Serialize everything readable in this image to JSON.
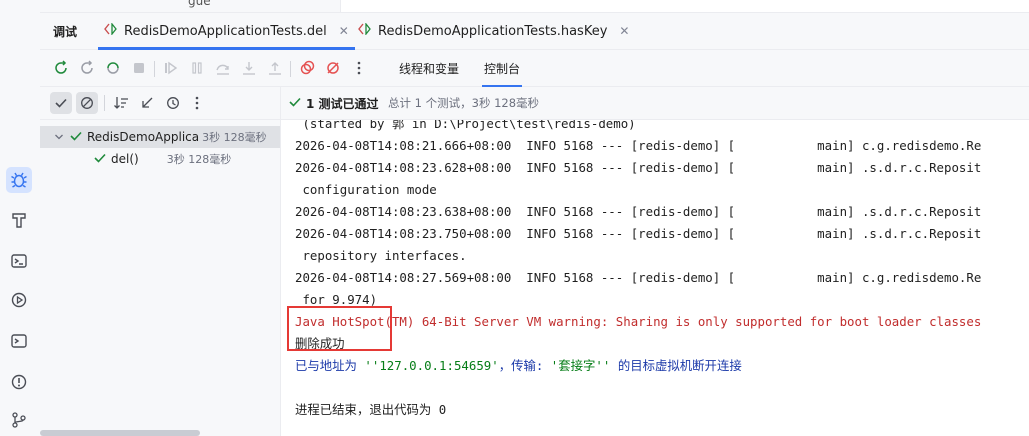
{
  "top_sliver": {
    "text": "gue"
  },
  "debug_panel": {
    "title": "调试",
    "tabs": [
      {
        "label": "RedisDemoApplicationTests.del",
        "active": true
      },
      {
        "label": "RedisDemoApplicationTests.hasKey",
        "active": false
      }
    ],
    "sub_tabs": [
      {
        "label": "线程和变量",
        "active": false
      },
      {
        "label": "控制台",
        "active": true
      }
    ]
  },
  "tests": {
    "status": "1 测试已通过",
    "summary": "总计 1 个测试，3秒 128毫秒",
    "tree": [
      {
        "label": "RedisDemoApplica",
        "duration": "3秒 128毫秒",
        "level": 0,
        "selected": true
      },
      {
        "label": "del()",
        "duration": "3秒 128毫秒",
        "level": 1,
        "selected": false
      }
    ]
  },
  "console": {
    "lines": [
      {
        "text": " (started by 郭 in D:\\Project\\test\\redis-demo)"
      },
      {
        "text": "2026-04-08T14:08:21.666+08:00  INFO 5168 --- [redis-demo] [           main] c.g.redisdemo.Re"
      },
      {
        "text": "2026-04-08T14:08:23.628+08:00  INFO 5168 --- [redis-demo] [           main] .s.d.r.c.Reposit"
      },
      {
        "text": " configuration mode"
      },
      {
        "text": "2026-04-08T14:08:23.638+08:00  INFO 5168 --- [redis-demo] [           main] .s.d.r.c.Reposit"
      },
      {
        "text": "2026-04-08T14:08:23.750+08:00  INFO 5168 --- [redis-demo] [           main] .s.d.r.c.Reposit"
      },
      {
        "text": " repository interfaces."
      },
      {
        "text": "2026-04-08T14:08:27.569+08:00  INFO 5168 --- [redis-demo] [           main] c.g.redisdemo.Re"
      },
      {
        "text": " for 9.974)"
      },
      {
        "text": "Java HotSpot(TM) 64-Bit Server VM warning: Sharing is only supported for boot loader classes"
      },
      {
        "text": "删除成功"
      },
      {
        "text_prefix": "已与地址为 ",
        "text_addr": "''127.0.0.1:54659'",
        "text_mid": "，传输: ",
        "text_trans": "'套接字''",
        "text_suffix": " 的目标虚拟机断开连接"
      },
      {
        "text": ""
      },
      {
        "text": "进程已结束，退出代码为 0"
      }
    ]
  },
  "colors": {
    "accent": "#3574f0",
    "pass_green": "#208a3c",
    "warning_red": "#c12d2d",
    "highlight_box": "#e53935"
  }
}
